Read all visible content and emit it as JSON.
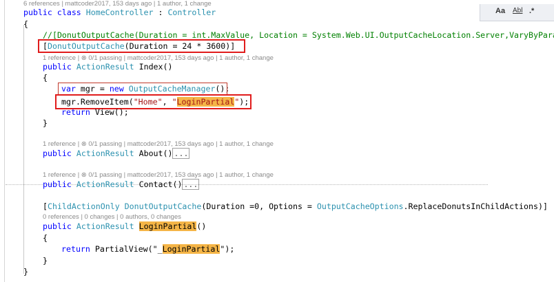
{
  "codelens": {
    "class": "6 references | mattcoder2017, 153 days ago | 1 author, 1 change",
    "index": "1 reference | ⊗ 0/1 passing | mattcoder2017, 153 days ago | 1 author, 1 change",
    "about": "1 reference | ⊗ 0/1 passing | mattcoder2017, 153 days ago | 1 author, 1 change",
    "contact": "1 reference | ⊗ 0/1 passing | mattcoder2017, 153 days ago | 1 author, 1 change",
    "login": "0 references | 0 changes | 0 authors, 0 changes"
  },
  "code": {
    "public": "public",
    "class_kw": "class",
    "class_name": "HomeController",
    "colon": " : ",
    "base_class": "Controller",
    "open_brace": "{",
    "close_brace": "}",
    "comment_line": "//[DonutOutputCache(Duration = int.MaxValue, Location = System.Web.UI.OutputCacheLocation.Server,VaryByParam",
    "attr_open": "[",
    "attr_name": "DonutOutputCache",
    "attr_args": "(Duration = 24 * 3600)]",
    "action_result": "ActionResult",
    "index_name": " Index()",
    "var_kw": "var",
    "mgr_decl": " mgr = ",
    "new_kw": "new",
    "manager_type": "OutputCacheManager",
    "call_end": "();",
    "remove_call": "mgr.RemoveItem(",
    "home_str": "\"Home\"",
    "comma": ", ",
    "quote": "\"",
    "login_partial": "LoginPartial",
    "remove_end": ");",
    "return_kw": "return",
    "view_call": " View();",
    "about_name": " About()",
    "contact_name": " Contact()",
    "ellipsis": "...",
    "child_open": "[",
    "child_action": "ChildActionOnly",
    "donut_cache": "DonutOutputCache",
    "child_args_1": "(Duration =0, Options = ",
    "options_enum": "OutputCacheOptions",
    "child_args_2": ".ReplaceDonutsInChildActions)]",
    "login_method": "LoginPartial",
    "paren": "()",
    "partial_call": " PartialView(\"_",
    "partial_end": "\");"
  },
  "findbar": {
    "match_case": "Aa",
    "whole_word": "Abl",
    "regex": ".*"
  }
}
